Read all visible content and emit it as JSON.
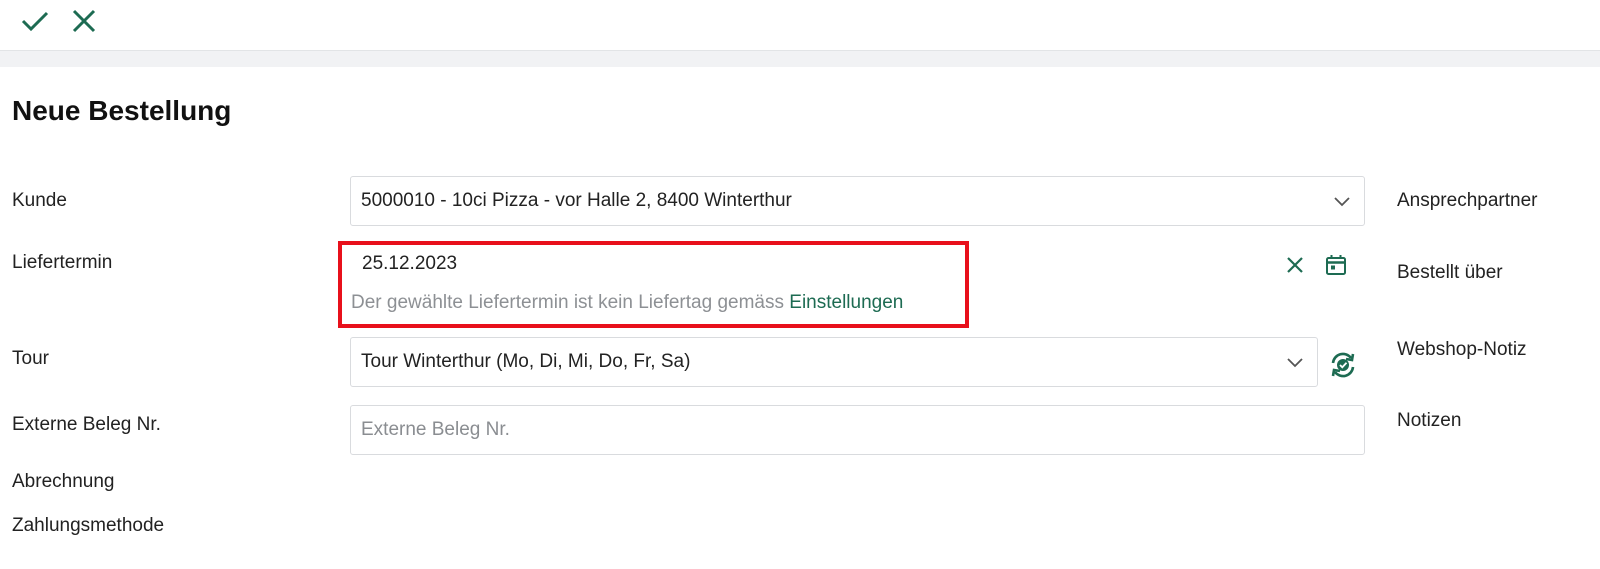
{
  "toolbar": {
    "confirm_icon": "check-icon",
    "cancel_icon": "close-icon"
  },
  "colors": {
    "accent": "#1d6b52",
    "error_border": "#e8101b",
    "hint_text": "#8d9094"
  },
  "page": {
    "title": "Neue Bestellung"
  },
  "form": {
    "customer": {
      "label": "Kunde",
      "value": "5000010 - 10ci Pizza - vor Halle 2, 8400 Winterthur"
    },
    "delivery_date": {
      "label": "Liefertermin",
      "value": "25.12.2023",
      "hint": "Der gewählte Liefertermin ist kein Liefertag gemäss ",
      "hint_link": "Einstellungen"
    },
    "tour": {
      "label": "Tour",
      "value": "Tour Winterthur (Mo, Di, Mi, Do, Fr, Sa)"
    },
    "external_ref": {
      "label": "Externe Beleg Nr.",
      "placeholder": "Externe Beleg Nr."
    },
    "billing": {
      "label": "Abrechnung"
    },
    "payment_method": {
      "label": "Zahlungsmethode"
    }
  },
  "side": {
    "contact": "Ansprechpartner",
    "ordered_via": "Bestellt über",
    "webshop_note": "Webshop-Notiz",
    "notes": "Notizen"
  }
}
